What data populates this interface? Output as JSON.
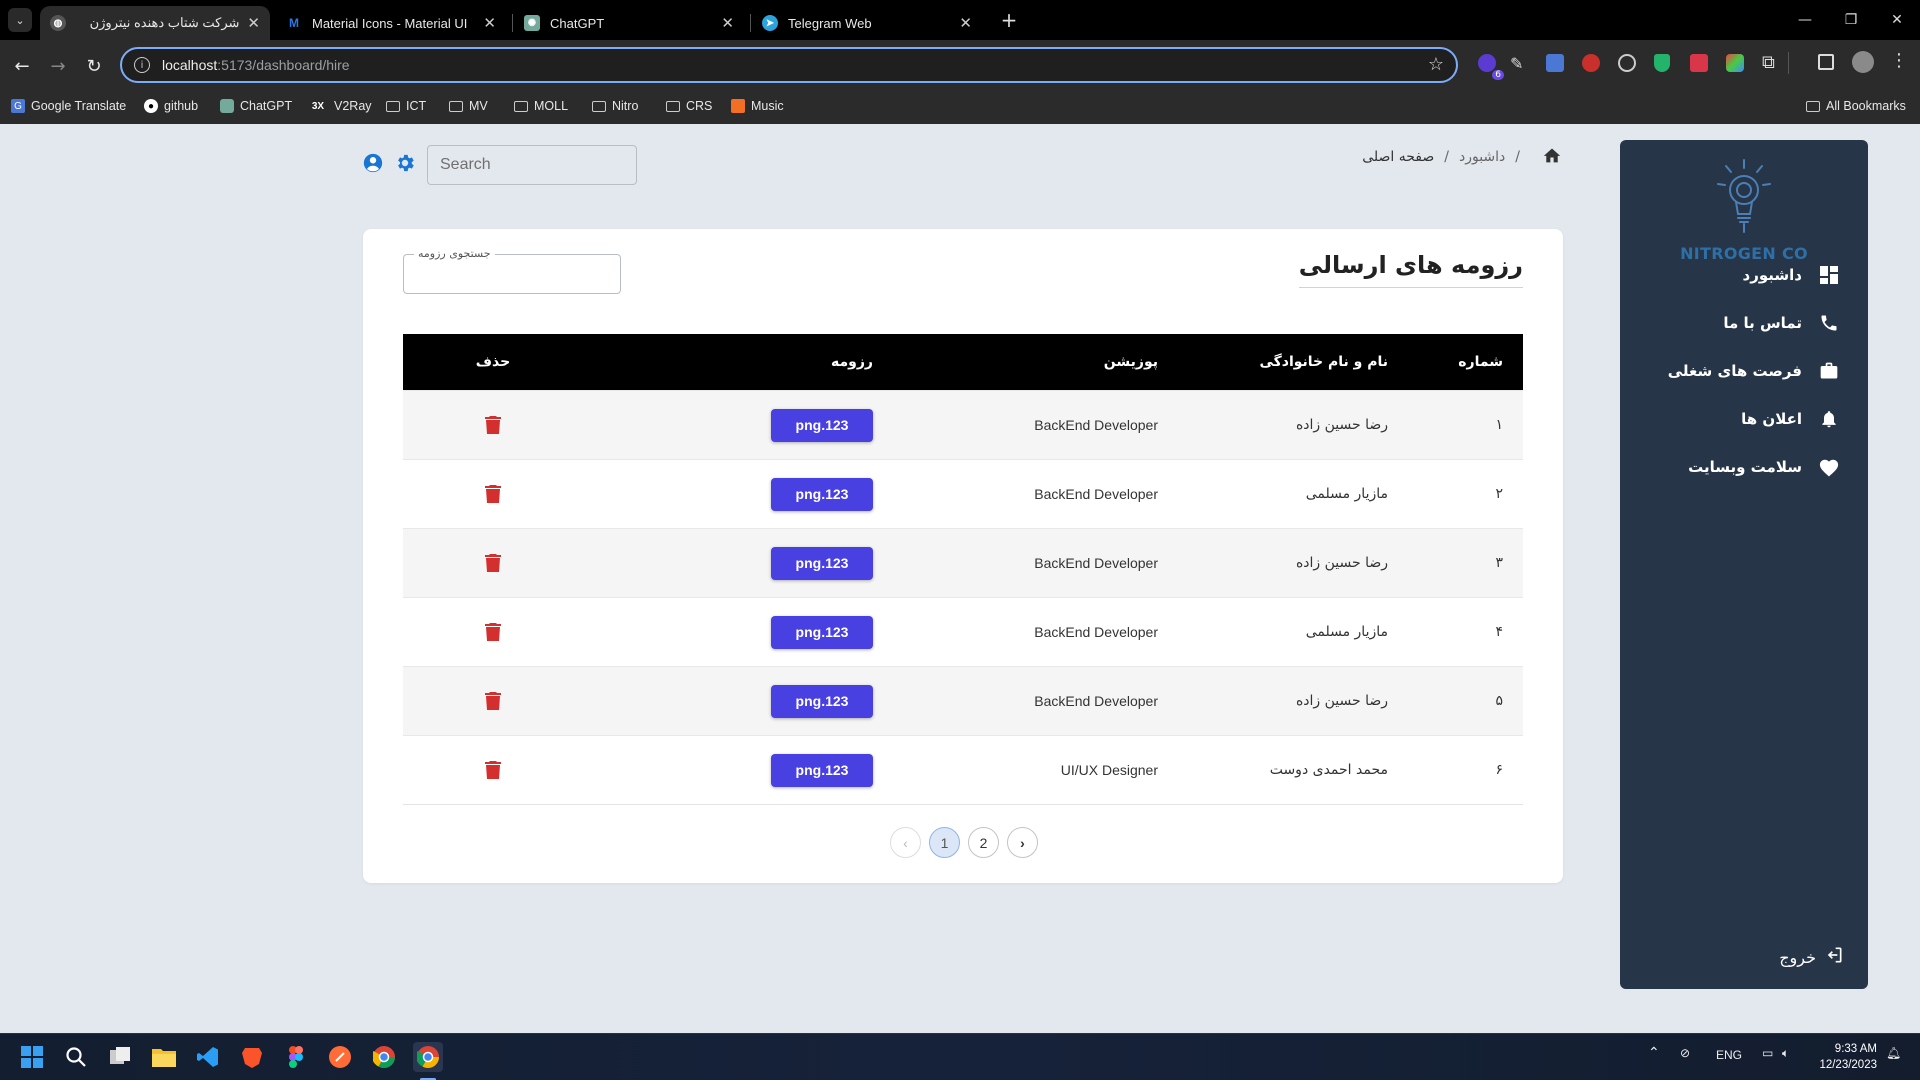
{
  "browser": {
    "tabs": [
      {
        "label": "شرکت شتاب دهنده نیتروژن",
        "active": true
      },
      {
        "label": "Material Icons - Material UI",
        "active": false
      },
      {
        "label": "ChatGPT",
        "active": false
      },
      {
        "label": "Telegram Web",
        "active": false
      }
    ],
    "url_host": "localhost",
    "url_rest": ":5173/dashboard/hire",
    "bookmarks": [
      "Google Translate",
      "github",
      "ChatGPT",
      "V2Ray",
      "ICT",
      "MV",
      "MOLL",
      "Nitro",
      "CRS",
      "Music"
    ],
    "all_bookmarks": "All Bookmarks",
    "extension_badge": "6"
  },
  "sidebar": {
    "logo_text": "NITROGEN CO",
    "items": [
      {
        "label": "داشبورد",
        "icon": "dashboard-icon"
      },
      {
        "label": "تماس با ما",
        "icon": "phone-icon"
      },
      {
        "label": "فرصت های شغلی",
        "icon": "work-icon"
      },
      {
        "label": "اعلان ها",
        "icon": "bell-icon"
      },
      {
        "label": "سلامت وبسایت",
        "icon": "heart-icon"
      }
    ],
    "logout_label": "خروج"
  },
  "breadcrumb": {
    "dashboard": "داشبورد",
    "current": "صفحه اصلی"
  },
  "header": {
    "search_placeholder": "Search"
  },
  "card": {
    "title": "رزومه های ارسالی",
    "filter_label": "جستجوی رزومه",
    "columns": {
      "number": "شماره",
      "name": "نام و نام خانوادگی",
      "position": "پوزیشن",
      "resume": "رزومه",
      "delete": "حذف"
    },
    "rows": [
      {
        "number": "۱",
        "name": "رضا حسین زاده",
        "position": "BackEnd Developer",
        "resume": "png.123"
      },
      {
        "number": "۲",
        "name": "مازیار مسلمی",
        "position": "BackEnd Developer",
        "resume": "png.123"
      },
      {
        "number": "۳",
        "name": "رضا حسین زاده",
        "position": "BackEnd Developer",
        "resume": "png.123"
      },
      {
        "number": "۴",
        "name": "مازیار مسلمی",
        "position": "BackEnd Developer",
        "resume": "png.123"
      },
      {
        "number": "۵",
        "name": "رضا حسین زاده",
        "position": "BackEnd Developer",
        "resume": "png.123"
      },
      {
        "number": "۶",
        "name": "محمد احمدی دوست",
        "position": "UI/UX Designer",
        "resume": "png.123"
      }
    ],
    "pagination": {
      "pages": [
        "1",
        "2"
      ],
      "current": "1"
    }
  },
  "colors": {
    "sidebar_bg": "#263547",
    "accent_button": "#4840e0",
    "delete_icon": "#d32f2f",
    "header_icon_blue": "#1976d2"
  },
  "taskbar": {
    "language": "ENG",
    "time": "9:33 AM",
    "date": "12/23/2023"
  }
}
